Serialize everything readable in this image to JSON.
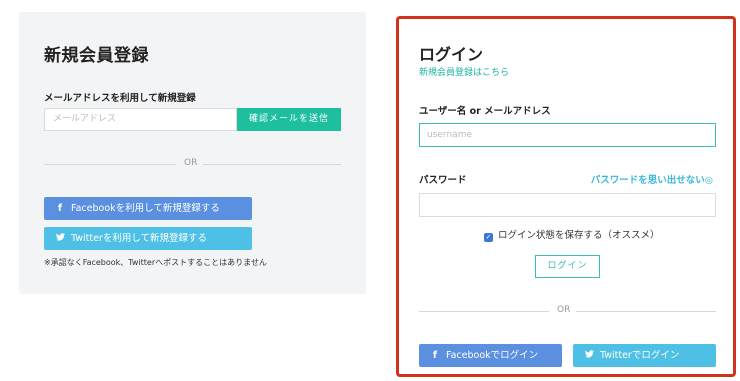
{
  "register": {
    "title": "新規会員登録",
    "email_label": "メールアドレスを利用して新規登録",
    "email_placeholder": "メールアドレス",
    "send_button": "確認メールを送信",
    "or_text": "OR",
    "facebook_button": "Facebookを利用して新規登録する",
    "twitter_button": "Twitterを利用して新規登録する",
    "note": "※承認なくFacebook、Twitterへポストすることはありません"
  },
  "login": {
    "title": "ログイン",
    "register_link": "新規会員登録はこちら",
    "username_label": "ユーザー名 or メールアドレス",
    "username_placeholder": "username",
    "password_label": "パスワード",
    "forgot_link": "パスワードを思い出せない◎",
    "remember_label": "ログイン状態を保存する（オススメ）",
    "remember_checked": true,
    "login_button": "ログイン",
    "or_text": "OR",
    "facebook_button": "Facebookでログイン",
    "twitter_button": "Twitterでログイン"
  },
  "icons": {
    "facebook": "f",
    "twitter": "🐦",
    "check": "✓"
  },
  "colors": {
    "teal": "#1dbf9f",
    "facebook": "#5b8fe0",
    "twitter": "#4ec0e6",
    "highlight_border": "#d0321c"
  }
}
